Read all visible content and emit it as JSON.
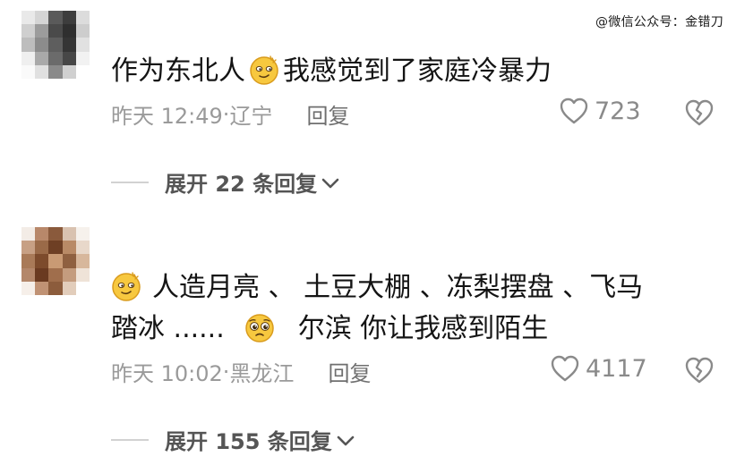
{
  "watermark": "@微信公众号：金错刀",
  "comments": [
    {
      "text_parts": [
        "作为东北人",
        "我感觉到了家庭冷暴力"
      ],
      "time": "昨天 12:49",
      "location": "辽宁",
      "reply_label": "回复",
      "likes": "723",
      "expand_label": "展开 22 条回复"
    },
    {
      "line1_parts": [
        "人造月亮 、 土豆大棚 、冻梨摆盘 、飞马"
      ],
      "line2_parts": [
        "踏冰 ......",
        "尔滨  你让我感到陌生"
      ],
      "time": "昨天 10:02",
      "location": "黑龙江",
      "reply_label": "回复",
      "likes": "4117",
      "expand_label": "展开 155 条回复"
    }
  ],
  "icons": {
    "like": "heart-outline-icon",
    "dislike": "broken-heart-icon",
    "expand": "chevron-down-icon",
    "emoji_1": "smirk-emoji-icon",
    "emoji_2": "pleading-emoji-icon"
  },
  "colors": {
    "text": "#141414",
    "meta": "#9a9a9a",
    "icon": "#8a8a8a"
  }
}
